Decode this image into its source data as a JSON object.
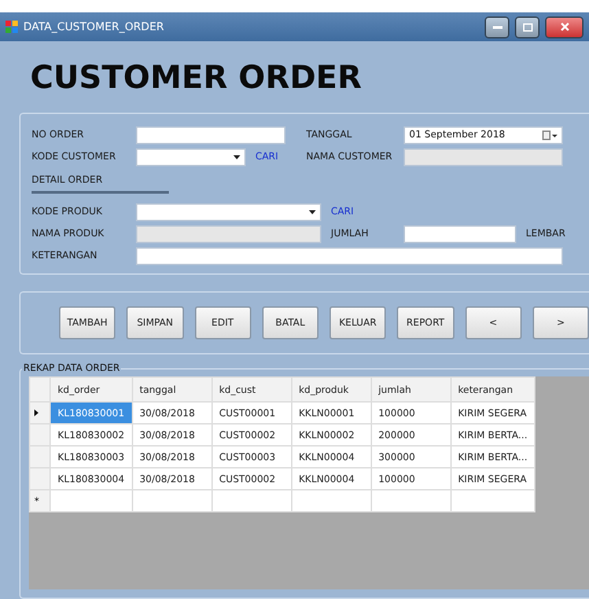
{
  "window": {
    "title": "DATA_CUSTOMER_ORDER"
  },
  "heading": "CUSTOMER ORDER",
  "form": {
    "no_order": {
      "label": "NO ORDER"
    },
    "tanggal": {
      "label": "TANGGAL",
      "value": "01 September 2018"
    },
    "kode_customer": {
      "label": "KODE CUSTOMER",
      "link": "CARI"
    },
    "nama_customer": {
      "label": "NAMA CUSTOMER",
      "disabled": true
    },
    "detail_title": "DETAIL ORDER",
    "kode_produk": {
      "label": "KODE PRODUK",
      "link": "CARI"
    },
    "nama_produk": {
      "label": "NAMA PRODUK",
      "disabled": true
    },
    "jumlah": {
      "label": "JUMLAH",
      "unit": "LEMBAR"
    },
    "keterangan": {
      "label": "KETERANGAN"
    }
  },
  "buttons": [
    "TAMBAH",
    "SIMPAN",
    "EDIT",
    "BATAL",
    "KELUAR",
    "REPORT",
    "<",
    ">"
  ],
  "table": {
    "title": "REKAP DATA ORDER",
    "new_row_marker": "*",
    "columns": [
      "kd_order",
      "tanggal",
      "kd_cust",
      "kd_produk",
      "jumlah",
      "keterangan"
    ],
    "rows": [
      {
        "selected": true,
        "cells": [
          "KL180830001",
          "30/08/2018",
          "CUST00001",
          "KKLN00001",
          "100000",
          "KIRIM SEGERA"
        ]
      },
      {
        "selected": false,
        "cells": [
          "KL180830002",
          "30/08/2018",
          "CUST00002",
          "KKLN00002",
          "200000",
          "KIRIM BERTA..."
        ]
      },
      {
        "selected": false,
        "cells": [
          "KL180830003",
          "30/08/2018",
          "CUST00003",
          "KKLN00004",
          "300000",
          "KIRIM BERTA..."
        ]
      },
      {
        "selected": false,
        "cells": [
          "KL180830004",
          "30/08/2018",
          "CUST00002",
          "KKLN00004",
          "100000",
          "KIRIM SEGERA"
        ]
      }
    ]
  }
}
